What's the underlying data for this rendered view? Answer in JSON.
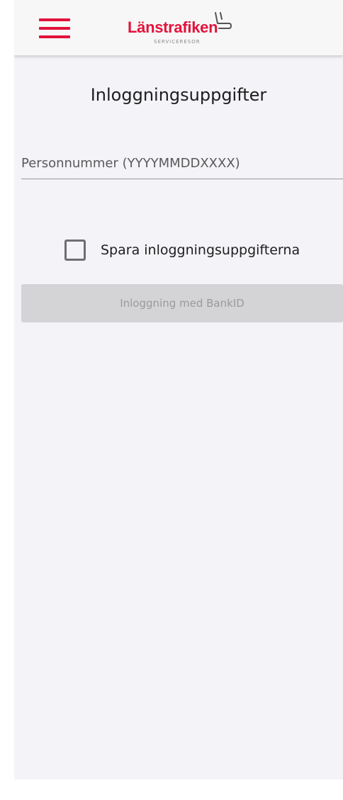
{
  "header": {
    "menu_icon": "hamburger-menu-icon",
    "logo": {
      "brand": "Länstrafiken",
      "subtitle": "SERVICERESOR",
      "icon": "seat-icon"
    }
  },
  "page": {
    "title": "Inloggningsuppgifter"
  },
  "login_form": {
    "personnummer_placeholder": "Personnummer (YYYYMMDDXXXX)",
    "personnummer_value": "",
    "remember_label": "Spara inloggningsuppgifterna",
    "remember_checked": false,
    "submit_label": "Inloggning med BankID",
    "submit_enabled": false
  },
  "colors": {
    "brand_red": "#e3123b",
    "background": "#f3f3f8",
    "button_disabled": "#d4d4d6"
  }
}
